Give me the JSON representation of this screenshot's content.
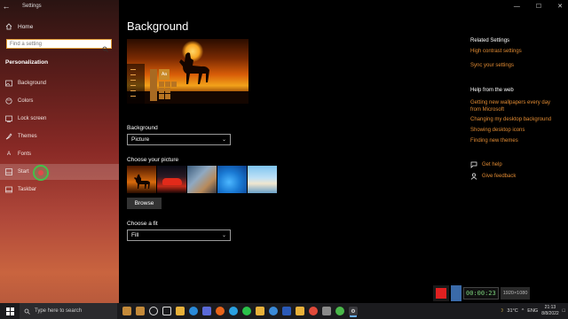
{
  "window": {
    "title": "Settings",
    "minimize": "—",
    "maximize": "☐",
    "close": "✕"
  },
  "sidebar": {
    "home": "Home",
    "search_placeholder": "Find a setting",
    "section": "Personalization",
    "items": [
      {
        "label": "Background",
        "icon": "image-icon"
      },
      {
        "label": "Colors",
        "icon": "palette-icon"
      },
      {
        "label": "Lock screen",
        "icon": "lock-screen-icon"
      },
      {
        "label": "Themes",
        "icon": "brush-icon"
      },
      {
        "label": "Fonts",
        "icon": "font-icon"
      },
      {
        "label": "Start",
        "icon": "start-icon",
        "selected": true
      },
      {
        "label": "Taskbar",
        "icon": "taskbar-icon"
      }
    ]
  },
  "main": {
    "title": "Background",
    "preview_tile_label": "Aa",
    "background_label": "Background",
    "background_value": "Picture",
    "choose_picture_label": "Choose your picture",
    "browse_label": "Browse",
    "fit_label": "Choose a fit",
    "fit_value": "Fill"
  },
  "related": {
    "heading": "Related Settings",
    "links": [
      "High contrast settings",
      "Sync your settings"
    ]
  },
  "help": {
    "heading": "Help from the web",
    "links": [
      "Getting new wallpapers every day",
      "from Microsoft",
      "Changing my desktop background",
      "Showing desktop icons",
      "Finding new themes"
    ]
  },
  "support": {
    "get_help": "Get help",
    "give_feedback": "Give feedback"
  },
  "recorder": {
    "time": "00:00:23",
    "info": "1920×1080"
  },
  "taskbar": {
    "search_placeholder": "Type here to search",
    "weather": "31°C",
    "language": "ENG",
    "time": "21:13",
    "date": "8/8/2022"
  },
  "colors": {
    "accent": "#e08a32",
    "sidebar_top": "#2a1412",
    "sidebar_bottom": "#c9643f"
  }
}
